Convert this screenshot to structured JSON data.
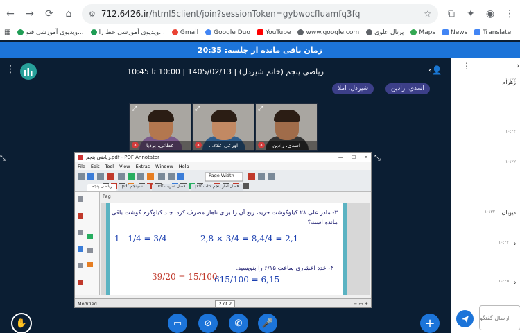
{
  "browser": {
    "url_host": "712.6426.ir",
    "url_path": "/html5client/join?sessionToken=gybwocfluamfq3fq",
    "bookmarks": [
      {
        "label": "ویدیوی آموزشی فتو...",
        "color": "#1f9d55"
      },
      {
        "label": "ویدیوی آموزشی خط را...",
        "color": "#1f9d55"
      },
      {
        "label": "Gmail",
        "color": "#ea4335"
      },
      {
        "label": "Google Duo",
        "color": "#4285f4"
      },
      {
        "label": "YouTube",
        "color": "#ff0000"
      },
      {
        "label": "www.google.com",
        "color": "#5f6368"
      },
      {
        "label": "پرتال علوی",
        "color": "#5f6368"
      },
      {
        "label": "Maps",
        "color": "#34a853"
      },
      {
        "label": "News",
        "color": "#4285f4"
      },
      {
        "label": "Translate",
        "color": "#4285f4"
      }
    ]
  },
  "session": {
    "remaining_text": "زمان باقی مانده از جلسه: 20:35"
  },
  "meeting": {
    "title": "ریاضی پنجم (خانم شیردل) | 1405/02/13 | 10:00 تا 10:45",
    "tags": [
      "اسدی، رادین",
      "شیردل، املا"
    ]
  },
  "videos": [
    {
      "name": "عطائی، برديا",
      "shirt": "#7a5a8c"
    },
    {
      "name": "اورعی علاء...",
      "shirt": "#2f5d8c"
    },
    {
      "name": "اسدی، رادین",
      "shirt": "#333333"
    }
  ],
  "screenshare": {
    "window_title": "ریاضی پنجم.pdf - PDF Annotator",
    "menu": [
      "File",
      "Edit",
      "Tool",
      "View",
      "Extras",
      "Window",
      "Help"
    ],
    "zoom_label": "Page Width",
    "tabs": [
      "ریاضی پنجم",
      "...سیپنجم.pdf",
      "فصل تقریب.pdf",
      "فصل آمار پنجم کتاب.pdf"
    ],
    "page_field": "Pag",
    "problem3": "۳- مادر علی ۲۸ کیلوگوشت خرید، ربع آن را برای ناهار مصرف کرد. چند کیلوگرم گوشت باقی مانده است؟",
    "math1": "1 - 1/4 = 3/4",
    "math2": "2,8 × 3/4 = 8,4/4 = 2,1",
    "problem4": "۴- عدد اعشاری ساعت ۶/۱۵ را بنویسید.",
    "math3": "615/100 = 6,15",
    "math4": "39/20 = 15/100",
    "status_left": "Modified",
    "page_indicator": "2 of 2"
  },
  "chat": {
    "items": [
      {
        "text": "زهرام",
        "time": "۱۰:۲۲"
      },
      {
        "text": "",
        "time": "۱۰:۲۲"
      },
      {
        "text": "",
        "time": "۱۰:۲۲"
      },
      {
        "text": "دیوبان",
        "time": "۱۰:۳۲"
      },
      {
        "text": "د",
        "time": "۱۰:۲۲"
      },
      {
        "text": "د",
        "time": "۱۰:۲۵"
      }
    ],
    "input_placeholder": "ارسال گفتگو"
  },
  "colors": {
    "background": "#0b1e33",
    "accent": "#1c74d9",
    "banner": "#1c74d9",
    "app_icon": "#27a09a"
  }
}
